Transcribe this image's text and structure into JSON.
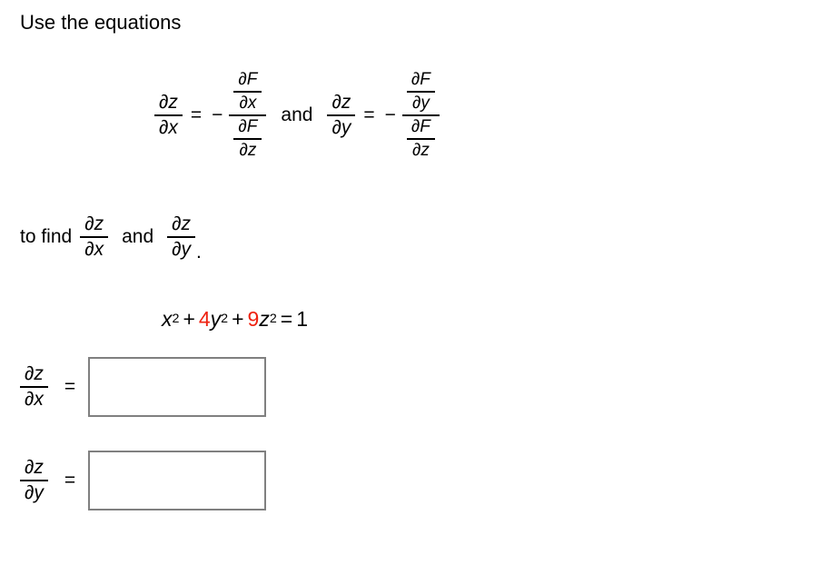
{
  "heading": "Use the equations",
  "symbols": {
    "partial": "∂",
    "equals": "=",
    "minus": "−",
    "plus": "+",
    "period": ".",
    "and": "and"
  },
  "formula_row": {
    "eq1": {
      "lhs": {
        "numerator": "∂z",
        "denominator": "∂x"
      },
      "equals": "=",
      "sign": "−",
      "rhs": {
        "numerator": {
          "numerator": "∂F",
          "denominator": "∂x"
        },
        "denominator": {
          "numerator": "∂F",
          "denominator": "∂z"
        }
      }
    },
    "conjunction": "and",
    "eq2": {
      "lhs": {
        "numerator": "∂z",
        "denominator": "∂y"
      },
      "equals": "=",
      "sign": "−",
      "rhs": {
        "numerator": {
          "numerator": "∂F",
          "denominator": "∂y"
        },
        "denominator": {
          "numerator": "∂F",
          "denominator": "∂z"
        }
      }
    }
  },
  "to_find": {
    "lead": "to find",
    "frac1": {
      "numerator": "∂z",
      "denominator": "∂x"
    },
    "conjunction": "and",
    "frac2": {
      "numerator": "∂z",
      "denominator": "∂y"
    },
    "period": "."
  },
  "surface_equation": {
    "terms": [
      {
        "coefficient": "",
        "variable": "x",
        "exponent": "2",
        "color": "#000000"
      },
      {
        "coefficient": "4",
        "variable": "y",
        "exponent": "2",
        "color": "#ee2211"
      },
      {
        "coefficient": "9",
        "variable": "z",
        "exponent": "2",
        "color": "#ee2211"
      }
    ],
    "operator": "+",
    "equals": "=",
    "rhs": "1",
    "full_text": "x² + 4y² + 9z² = 1"
  },
  "answers": [
    {
      "label": {
        "numerator": "∂z",
        "denominator": "∂x"
      },
      "equals": "=",
      "value": "",
      "placeholder": ""
    },
    {
      "label": {
        "numerator": "∂z",
        "denominator": "∂y"
      },
      "equals": "=",
      "value": "",
      "placeholder": ""
    }
  ],
  "colors": {
    "text": "#000000",
    "highlight": "#ee2211",
    "input_border": "#808080",
    "background": "#ffffff"
  }
}
